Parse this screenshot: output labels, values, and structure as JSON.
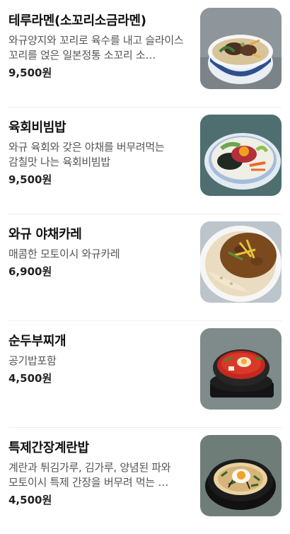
{
  "menu": {
    "items": [
      {
        "name": "테루라멘(소꼬리소금라멘)",
        "description": "와규양지와 꼬리로 육수를 내고 슬라이스 꼬리를 얹은 일본정통 소꼬리 소…",
        "price": "9,500원",
        "photo": "ramen-photo"
      },
      {
        "name": "육회비빔밥",
        "description": "와규 육회와 갖은 야채를 버무려먹는 감칠맛 나는 육회비빔밥",
        "price": "9,500원",
        "photo": "bibimbap-photo"
      },
      {
        "name": "와규 야채카레",
        "description": "매콤한 모토이시 와규카레",
        "price": "6,900원",
        "photo": "curry-photo"
      },
      {
        "name": "순두부찌개",
        "description": "공기밥포함",
        "price": "4,500원",
        "photo": "sundubu-photo"
      },
      {
        "name": "특제간장계란밥",
        "description": "계란과 튀김가루, 김가루, 양념된 파와 모토이시 특제 간장을 버무려 먹는 …",
        "price": "4,500원",
        "photo": "egg-rice-photo"
      }
    ]
  }
}
